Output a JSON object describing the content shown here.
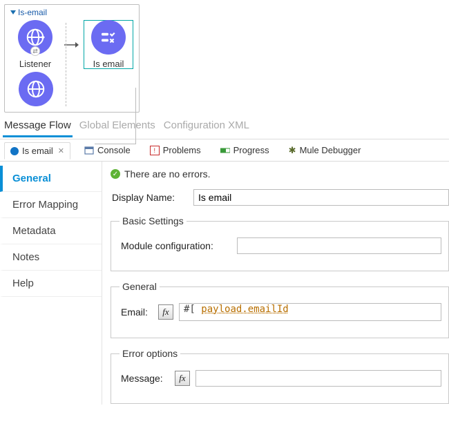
{
  "flow": {
    "title": "Is-email",
    "components": {
      "listener_label": "Listener",
      "is_email_label": "Is email"
    }
  },
  "editor_tabs": {
    "message_flow": "Message Flow",
    "global_elements": "Global Elements",
    "config_xml": "Configuration XML"
  },
  "panel_tabs": {
    "is_email": "Is email",
    "console": "Console",
    "problems": "Problems",
    "progress": "Progress",
    "mule_debugger": "Mule Debugger"
  },
  "props_nav": {
    "general": "General",
    "error_mapping": "Error Mapping",
    "metadata": "Metadata",
    "notes": "Notes",
    "help": "Help"
  },
  "props": {
    "no_errors": "There are no errors.",
    "display_name_label": "Display Name:",
    "display_name_value": "Is email",
    "basic_settings_legend": "Basic Settings",
    "module_config_label": "Module configuration:",
    "module_config_value": "",
    "general_legend": "General",
    "email_label": "Email:",
    "email_expression_prefix": "#[ ",
    "email_expression_body": "payload.emailId",
    "error_options_legend": "Error options",
    "message_label": "Message:",
    "message_value": ""
  }
}
